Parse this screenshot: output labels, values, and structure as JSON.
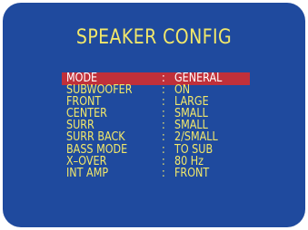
{
  "screen": {
    "title": "SPEAKER CONFIG"
  },
  "colors": {
    "background": "#1f4a9e",
    "text": "#f2e86a",
    "selected_text": "#ffffff",
    "selected_bg": "#c0303a"
  },
  "menu": {
    "separator": ":",
    "items": [
      {
        "label": "MODE",
        "value": "GENERAL",
        "selected": true
      },
      {
        "label": "SUBWOOFER",
        "value": "ON"
      },
      {
        "label": "FRONT",
        "value": "LARGE"
      },
      {
        "label": "CENTER",
        "value": "SMALL"
      },
      {
        "label": "SURR",
        "value": "SMALL"
      },
      {
        "label": "SURR BACK",
        "value": "2/SMALL"
      },
      {
        "label": "BASS MODE",
        "value": "TO SUB"
      },
      {
        "label": "X–OVER",
        "value": "80 Hz"
      },
      {
        "label": "INT AMP",
        "value": "FRONT"
      }
    ]
  }
}
